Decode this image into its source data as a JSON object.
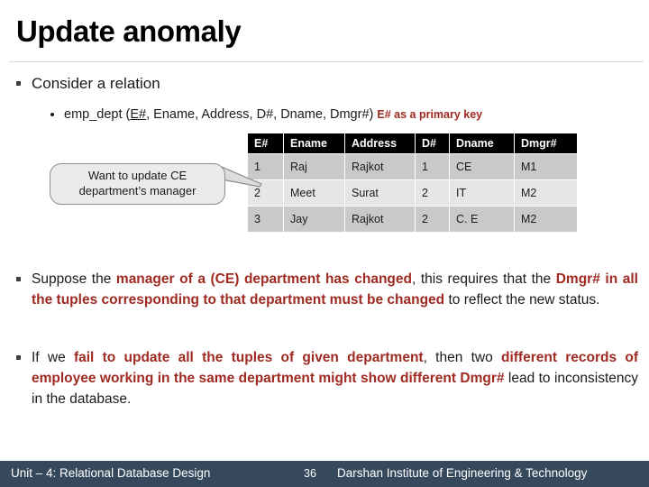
{
  "slide": {
    "title": "Update anomaly",
    "page_number": "36"
  },
  "bullets": {
    "consider": "Consider a relation",
    "relation": {
      "prefix": "emp_dept (",
      "key": "E#",
      "rest": ", Ename, Address, D#, Dname, Dmgr#)",
      "note": "E# as a primary key"
    }
  },
  "callout": {
    "line1": "Want to update CE",
    "line2": "department’s manager"
  },
  "table": {
    "headers": [
      "E#",
      "Ename",
      "Address",
      "D#",
      "Dname",
      "Dmgr#"
    ],
    "rows": [
      {
        "e": "1",
        "ename": "Raj",
        "address": "Rajkot",
        "d": "1",
        "dname": "CE",
        "dmgr": "M1"
      },
      {
        "e": "2",
        "ename": "Meet",
        "address": "Surat",
        "d": "2",
        "dname": "IT",
        "dmgr": "M2"
      },
      {
        "e": "3",
        "ename": "Jay",
        "address": "Rajkot",
        "d": "2",
        "dname": "C. E",
        "dmgr": "M2"
      }
    ]
  },
  "paragraphs": {
    "p1": {
      "t1": "Suppose the ",
      "e1": "manager of a (CE) department has changed",
      "t2": ", this requires that the ",
      "e2": "Dmgr# in all the tuples corresponding to that department must be changed",
      "t3": " to reflect the new status."
    },
    "p2": {
      "t1": "If we ",
      "e1": "fail to update all the tuples of given department",
      "t2": ", then two ",
      "e2": "different records of employee working in the same department might show different Dmgr#",
      "t3": " lead to inconsistency in the database."
    }
  },
  "footer": {
    "unit": "Unit – 4: Relational Database Design",
    "page": "36",
    "institute": "Darshan Institute of Engineering & Technology"
  },
  "colors": {
    "accent_red": "#9e2a21",
    "footer_bg": "#36495c",
    "header_bg": "#000000",
    "row_dark": "#c9c9c9",
    "row_light": "#e6e6e6"
  }
}
